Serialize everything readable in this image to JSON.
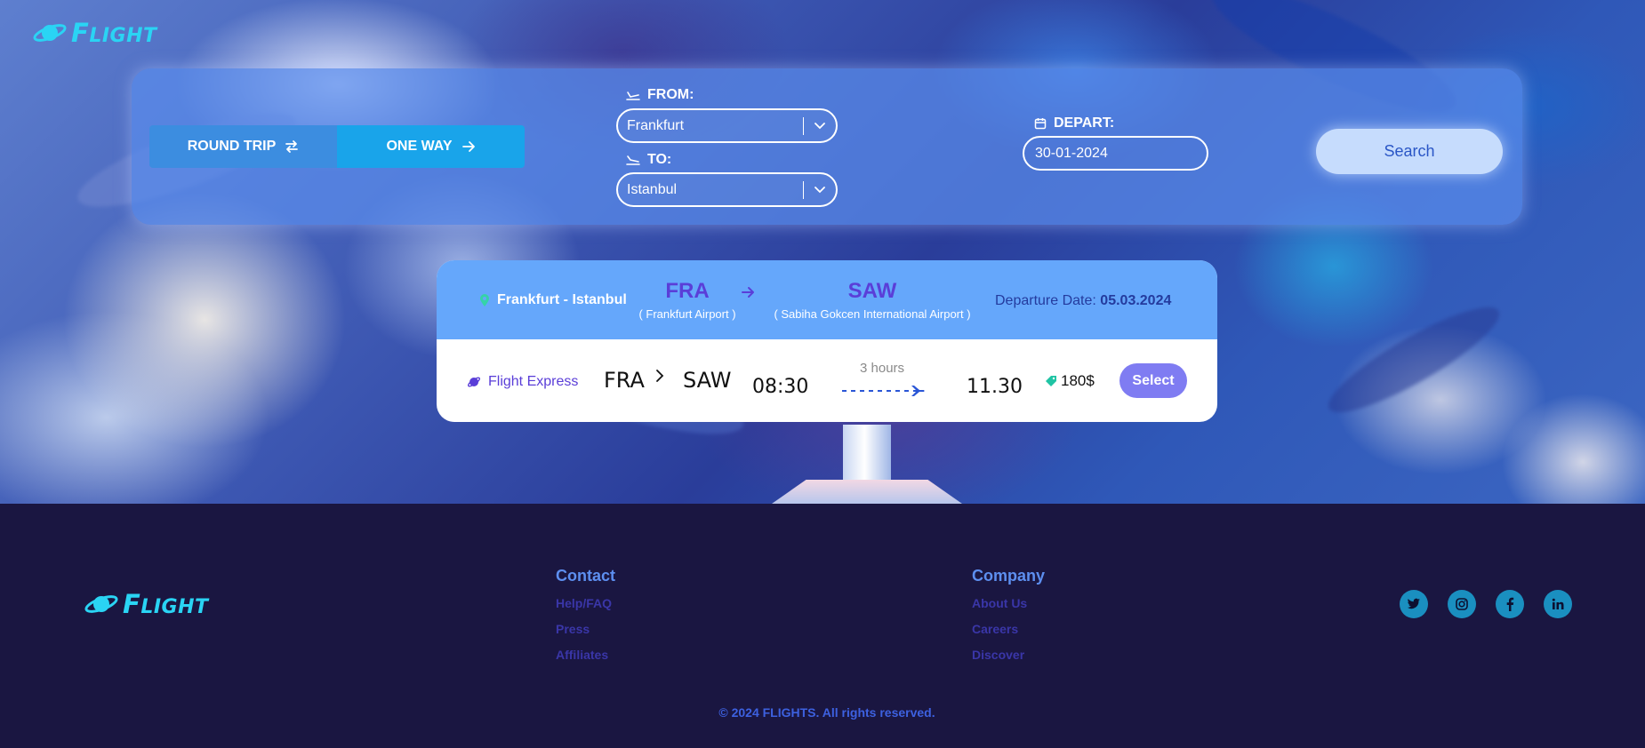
{
  "brand": {
    "logo_text": "Flight"
  },
  "search": {
    "round_trip_label": "ROUND TRIP",
    "one_way_label": "ONE WAY",
    "from_label": "FROM:",
    "from_value": "Frankfurt",
    "to_label": "TO:",
    "to_value": "Istanbul",
    "depart_label": "DEPART:",
    "depart_value": "30-01-2024",
    "search_label": "Search"
  },
  "result": {
    "route_name": "Frankfurt - Istanbul",
    "origin_code": "FRA",
    "origin_airport": "( Frankfurt Airport )",
    "destination_code": "SAW",
    "destination_airport": "( Sabiha Gokcen International Airport )",
    "departure_date_label": "Departure Date:",
    "departure_date_value": "05.03.2024",
    "carrier": "Flight Express",
    "from_code": "FRA",
    "to_code": "SAW",
    "depart_time": "08:30",
    "arrive_time": "11.30",
    "duration": "3 hours",
    "price": "180$",
    "select_label": "Select"
  },
  "footer": {
    "contact_heading": "Contact",
    "contact_links": [
      "Help/FAQ",
      "Press",
      "Affiliates"
    ],
    "company_heading": "Company",
    "company_links": [
      "About Us",
      "Careers",
      "Discover"
    ],
    "socials": [
      "twitter-icon",
      "instagram-icon",
      "facebook-icon",
      "linkedin-icon"
    ],
    "copyright": "© 2024 FLIGHTS. All rights reserved."
  },
  "colors": {
    "accent_cyan": "#2ad4f4",
    "panel_blue": "#5a8ceb",
    "purple": "#5a3ed8",
    "select_button": "#7f7cf2",
    "footer_bg": "#1a1641"
  }
}
